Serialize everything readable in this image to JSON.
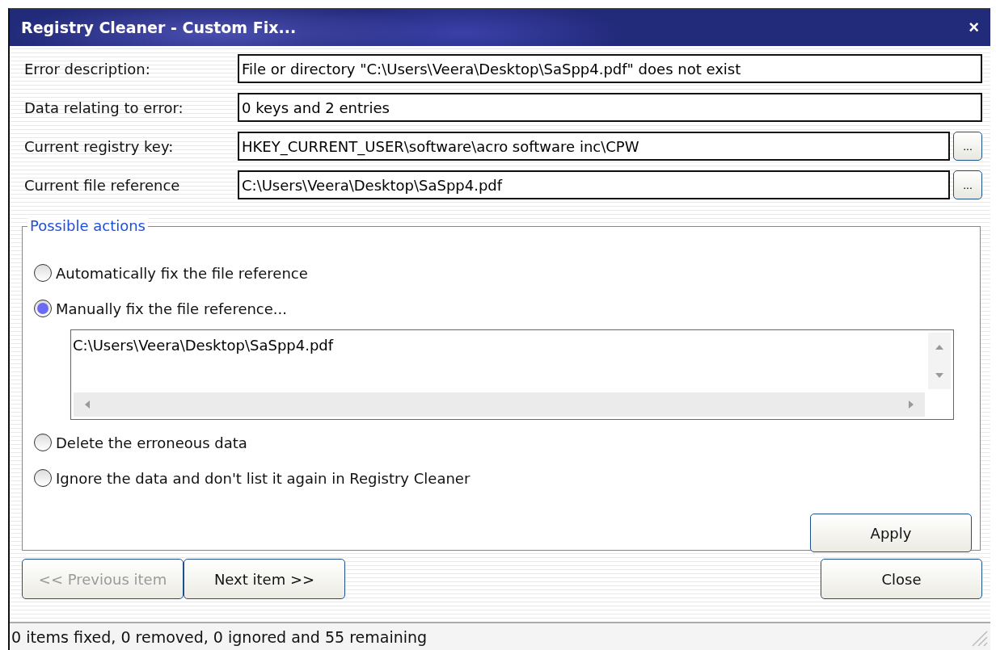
{
  "window": {
    "title": "Registry Cleaner - Custom Fix...",
    "close_glyph": "×"
  },
  "fields": [
    {
      "label": "Error description:",
      "value": "File or directory \"C:\\Users\\Veera\\Desktop\\SaSpp4.pdf\" does not exist"
    },
    {
      "label": "Data relating to error:",
      "value": "0 keys and 2 entries"
    },
    {
      "label": "Current registry key:",
      "value": "HKEY_CURRENT_USER\\software\\acro software inc\\CPW",
      "browse_button": "..."
    },
    {
      "label": "Current file reference",
      "value": "C:\\Users\\Veera\\Desktop\\SaSpp4.pdf",
      "browse_button": "..."
    }
  ],
  "possible_actions": {
    "title": "Possible actions",
    "options": [
      {
        "label": "Automatically fix the file reference",
        "selected": false
      },
      {
        "label": "Manually fix the file reference...",
        "selected": true
      },
      {
        "label": "Delete the erroneous data",
        "selected": false
      },
      {
        "label": "Ignore the data and don't list it again in Registry Cleaner",
        "selected": false
      }
    ],
    "manual_path": "C:\\Users\\Veera\\Desktop\\SaSpp4.pdf",
    "apply_button": "Apply"
  },
  "nav_buttons": [
    {
      "label": "<< Previous item",
      "disabled": true
    },
    {
      "label": "Next item >>",
      "disabled": false
    }
  ],
  "close_button": "Close",
  "status_bar": "0 items fixed, 0 removed, 0 ignored and 55 remaining"
}
